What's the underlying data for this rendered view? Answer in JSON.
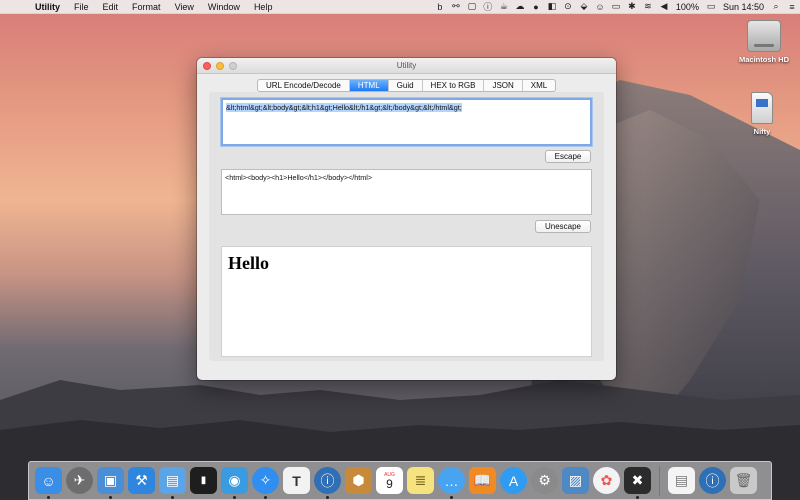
{
  "menubar": {
    "apple": "",
    "app_name": "Utility",
    "menus": [
      "File",
      "Edit",
      "Format",
      "View",
      "Window",
      "Help"
    ],
    "battery": "100%",
    "clock": "Sun 14:50",
    "status_icons": [
      "b",
      "⚯",
      "▢",
      "ⓘ",
      "☕",
      "☁",
      "●",
      "◧",
      "⊙",
      "⬙",
      "☺",
      "▭",
      "✱",
      "≋",
      "◀"
    ]
  },
  "desktop": {
    "items": [
      {
        "label": "Macintosh HD"
      },
      {
        "label": "Nifty"
      }
    ]
  },
  "window": {
    "title": "Utility",
    "tabs": [
      {
        "label": "URL Encode/Decode"
      },
      {
        "label": "HTML"
      },
      {
        "label": "Guid"
      },
      {
        "label": "HEX to RGB"
      },
      {
        "label": "JSON"
      },
      {
        "label": "XML"
      }
    ],
    "active_tab": "HTML",
    "input_text": "&lt;html&gt;&lt;body&gt;&lt;h1&gt;Hello&lt;/h1&gt;&lt;/body&gt;&lt;/html&gt;",
    "escape_label": "Escape",
    "output_text": "<html><body><h1>Hello</h1></body></html>",
    "unescape_label": "Unescape",
    "preview_heading": "Hello"
  },
  "dock": {
    "calendar_day": "9",
    "calendar_month": "AUG",
    "items": [
      {
        "icon": "finder-icon",
        "color": "#3a8ee6"
      },
      {
        "icon": "launchpad-icon",
        "color": "#6d6d6d"
      },
      {
        "icon": "preview-icon",
        "color": "#4a8fd6"
      },
      {
        "icon": "xcode-icon",
        "color": "#2e86de"
      },
      {
        "icon": "folder-icon",
        "color": "#5ba4e8"
      },
      {
        "icon": "terminal-icon",
        "color": "#1e1e1e"
      },
      {
        "icon": "tweetbot-icon",
        "color": "#3b9be0"
      },
      {
        "icon": "safari-icon",
        "color": "#2f8ef0"
      },
      {
        "icon": "typora-icon",
        "color": "#f2f2f2"
      },
      {
        "icon": "onepassword-icon",
        "color": "#2f6fb5"
      },
      {
        "icon": "archive-icon",
        "color": "#c78a3b"
      },
      {
        "icon": "calendar-icon",
        "color": "#ffffff"
      },
      {
        "icon": "notes-icon",
        "color": "#f6e27f"
      },
      {
        "icon": "messages-icon",
        "color": "#48a3f0"
      },
      {
        "icon": "ibooks-icon",
        "color": "#f08a24"
      },
      {
        "icon": "appstore-icon",
        "color": "#2f9cf2"
      },
      {
        "icon": "system-preferences-icon",
        "color": "#8a8a8a"
      },
      {
        "icon": "image-viewer-icon",
        "color": "#4f89c4"
      },
      {
        "icon": "photos-icon",
        "color": "#f3f3f3"
      },
      {
        "icon": "utility-tools-icon",
        "color": "#2b2b2b"
      },
      {
        "icon": "document-icon",
        "color": "#f4f4f4"
      },
      {
        "icon": "onepassword-mini-icon",
        "color": "#2f6fb5"
      },
      {
        "icon": "trash-icon",
        "color": "#c9c9c9"
      }
    ]
  }
}
